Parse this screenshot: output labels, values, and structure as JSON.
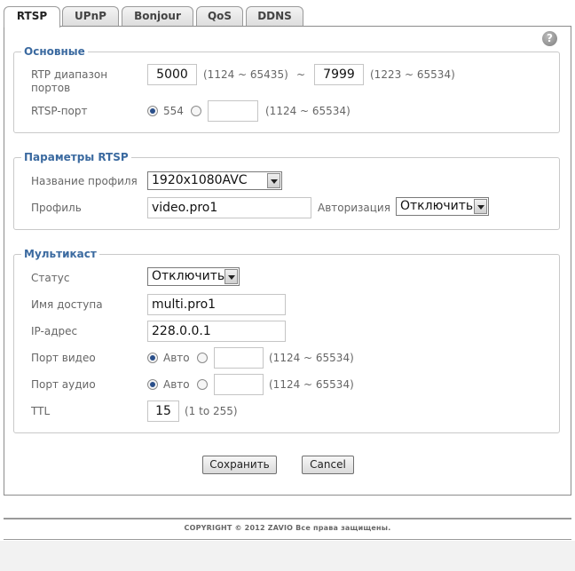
{
  "tabs": [
    "RTSP",
    "UPnP",
    "Bonjour",
    "QoS",
    "DDNS"
  ],
  "help_icon": "?",
  "basic": {
    "legend": "Основные",
    "rtp_label_line1": "RTP диапазон",
    "rtp_label_line2": "портов",
    "rtp_start": "5000",
    "rtp_start_range": "(1124 ~ 65435)",
    "tilde": "~",
    "rtp_end": "7999",
    "rtp_end_range": "(1223 ~ 65534)",
    "rtsp_label": "RTSP-порт",
    "rtsp_default": "554",
    "rtsp_custom": "",
    "rtsp_range": "(1124 ~ 65534)"
  },
  "rtsp_params": {
    "legend": "Параметры RTSP",
    "profile_name_label": "Название профиля",
    "profile_name_value": "1920x1080AVC",
    "profile_label": "Профиль",
    "profile_value": "video.pro1",
    "auth_label": "Авторизация",
    "auth_value": "Отключить"
  },
  "multicast": {
    "legend": "Мультикаст",
    "status_label": "Статус",
    "status_value": "Отключить",
    "access_label": "Имя доступа",
    "access_value": "multi.pro1",
    "ip_label": "IP-адрес",
    "ip_value": "228.0.0.1",
    "video_port_label": "Порт видео",
    "video_auto": "Авто",
    "video_custom": "",
    "video_range": "(1124 ~ 65534)",
    "audio_port_label": "Порт аудио",
    "audio_auto": "Авто",
    "audio_custom": "",
    "audio_range": "(1124 ~ 65534)",
    "ttl_label": "TTL",
    "ttl_value": "15",
    "ttl_range": "(1 to 255)"
  },
  "buttons": {
    "save": "Сохранить",
    "cancel": "Cancel"
  },
  "footer": "COPYRIGHT © 2012 ZAVIO Все права защищены.",
  "colors": {
    "legend": "#3b6aa0",
    "radio_checked": "#2a4f8a"
  }
}
